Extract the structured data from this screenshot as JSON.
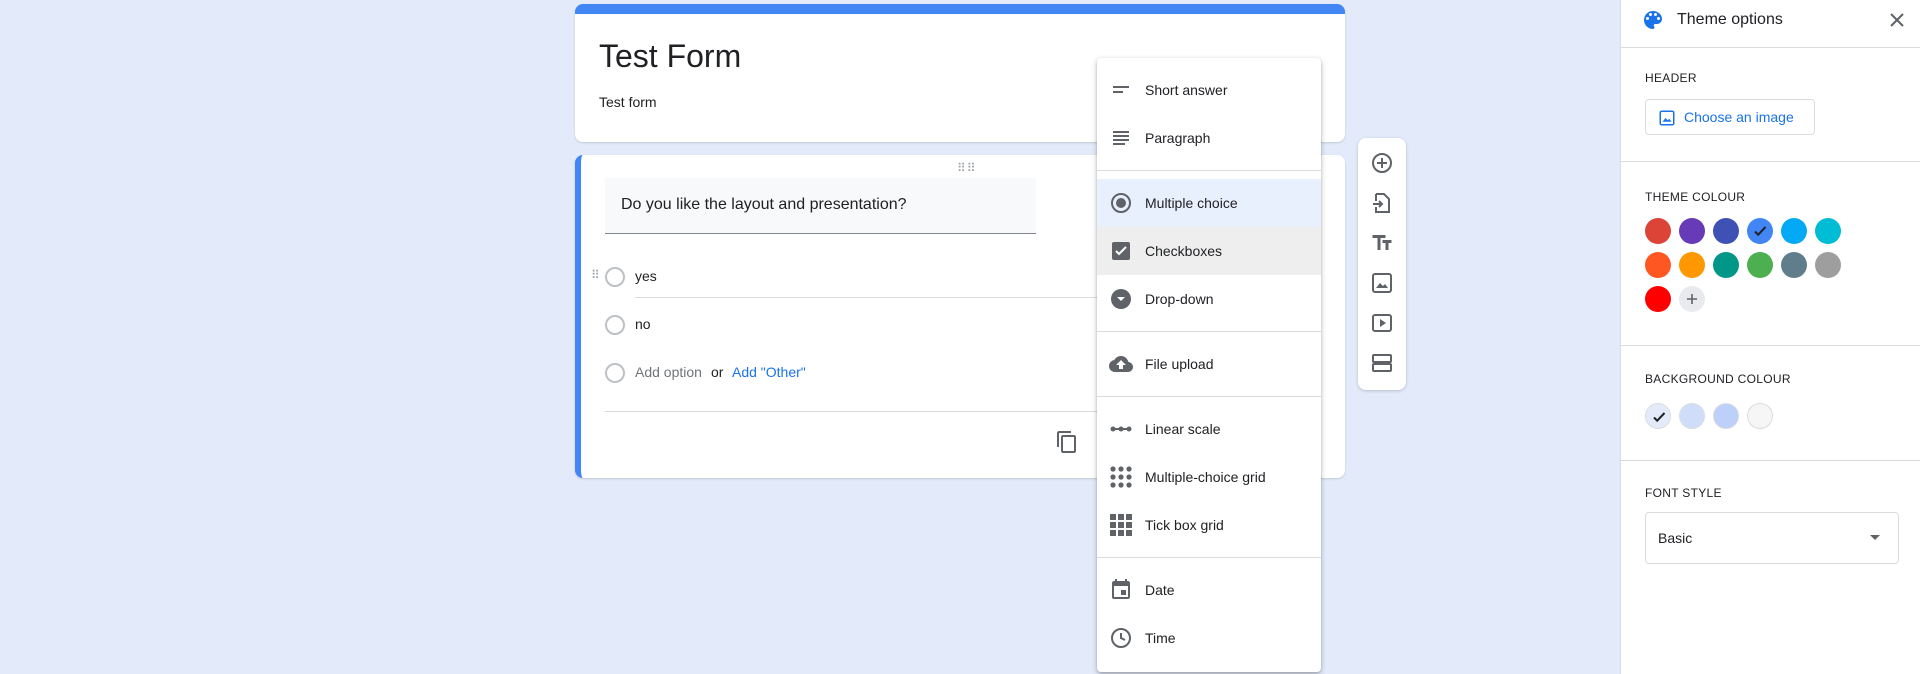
{
  "form": {
    "title": "Test Form",
    "description": "Test form"
  },
  "question": {
    "title": "Do you like the layout and presentation?",
    "options": [
      "yes",
      "no"
    ],
    "add_option": "Add option",
    "or_text": "or",
    "add_other": "Add \"Other\""
  },
  "menu": {
    "items": [
      {
        "label": "Short answer",
        "icon": "short-answer-icon"
      },
      {
        "label": "Paragraph",
        "icon": "paragraph-icon"
      },
      {
        "label": "Multiple choice",
        "icon": "radio-button-icon",
        "selected": true
      },
      {
        "label": "Checkboxes",
        "icon": "checkbox-icon",
        "hovered": true
      },
      {
        "label": "Drop-down",
        "icon": "dropdown-icon"
      },
      {
        "label": "File upload",
        "icon": "cloud-upload-icon"
      },
      {
        "label": "Linear scale",
        "icon": "linear-scale-icon"
      },
      {
        "label": "Multiple-choice grid",
        "icon": "grid-dots-icon"
      },
      {
        "label": "Tick box grid",
        "icon": "grid-squares-icon"
      },
      {
        "label": "Date",
        "icon": "calendar-icon"
      },
      {
        "label": "Time",
        "icon": "clock-icon"
      }
    ]
  },
  "toolbar": {
    "icons": [
      "add-question-icon",
      "import-questions-icon",
      "add-title-icon",
      "add-image-icon",
      "add-video-icon",
      "add-section-icon"
    ]
  },
  "theme_panel": {
    "title": "Theme options",
    "header_label": "HEADER",
    "choose_image": "Choose an image",
    "theme_colour_label": "THEME COLOUR",
    "theme_colours": [
      "#db4437",
      "#673ab7",
      "#3f51b5",
      "#4285f4",
      "#03a9f4",
      "#00bcd4",
      "#ff5722",
      "#ff9800",
      "#009688",
      "#4caf50",
      "#607d8b",
      "#9e9e9e",
      "#ff0000"
    ],
    "selected_theme_colour": "#4285f4",
    "background_colour_label": "BACKGROUND COLOUR",
    "background_colours": [
      "#e3ebfb",
      "#d0ddfa",
      "#bcd0f9",
      "#f6f6f6"
    ],
    "selected_background_colour": "#e3ebfb",
    "font_style_label": "FONT STYLE",
    "font_style_value": "Basic"
  },
  "colors": {
    "accent": "#4285f4",
    "page_background": "#e3ebfb",
    "link": "#1a73e8"
  }
}
